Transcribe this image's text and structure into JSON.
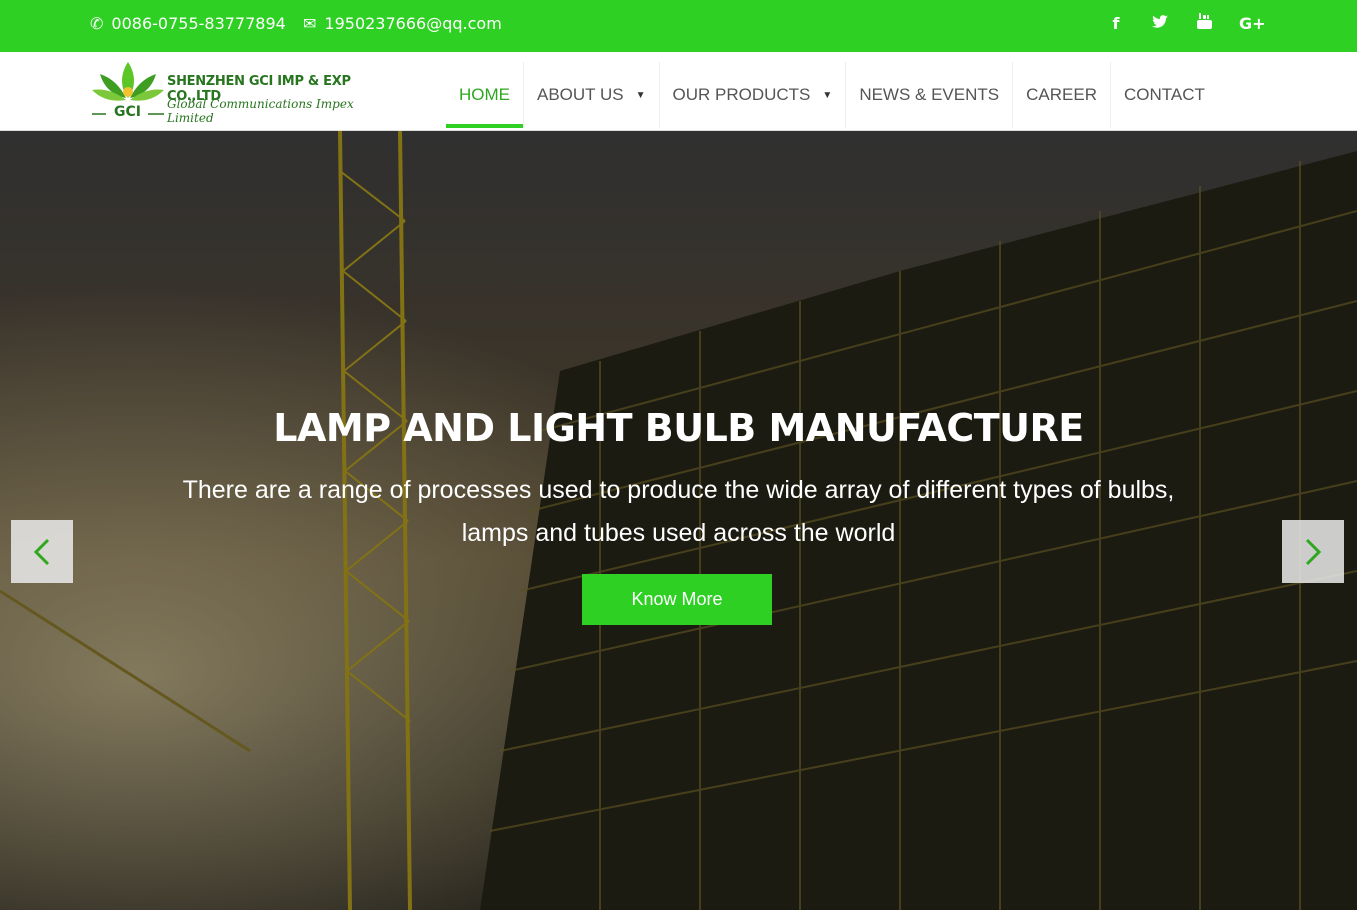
{
  "topbar": {
    "phone": "0086-0755-83777894",
    "email": "1950237666@qq.com",
    "social": [
      {
        "icon": "facebook-icon",
        "glyph": "f"
      },
      {
        "icon": "twitter-icon",
        "glyph": "t"
      },
      {
        "icon": "youtube-icon",
        "glyph": "▶"
      },
      {
        "icon": "google-plus-icon",
        "glyph": "G+"
      }
    ]
  },
  "logo": {
    "brand": "SHENZHEN GCI IMP & EXP CO.,LTD",
    "tagline": "Global Communications Impex Limited",
    "mark": "GCI"
  },
  "nav": {
    "items": [
      {
        "label": "HOME",
        "active": true
      },
      {
        "label": "ABOUT US",
        "dropdown": true
      },
      {
        "label": "OUR PRODUCTS",
        "dropdown": true
      },
      {
        "label": "NEWS & EVENTS"
      },
      {
        "label": "CAREER"
      },
      {
        "label": "CONTACT"
      }
    ]
  },
  "hero": {
    "title": "LAMP AND LIGHT BULB MANUFACTURE",
    "subtitle_line1": "There are a range of processes used to produce the wide array of different types of bulbs,",
    "subtitle_line2": "lamps and tubes used across the world",
    "button": "Know More"
  },
  "colors": {
    "accent": "#2ed123",
    "active_nav": "#2ea71f"
  }
}
